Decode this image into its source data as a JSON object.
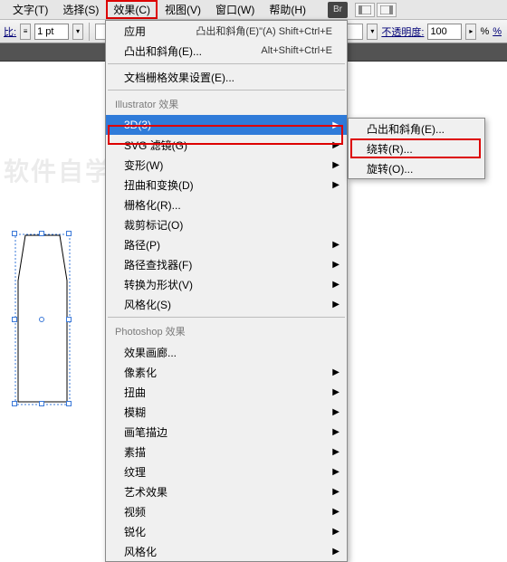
{
  "menubar": {
    "items": [
      "文字(T)",
      "选择(S)",
      "效果(C)",
      "视图(V)",
      "窗口(W)",
      "帮助(H)"
    ],
    "badge": "Br"
  },
  "toolbar": {
    "stroke_label": "比:",
    "stroke_value": "1 pt",
    "opacity_label": "不透明度:",
    "opacity_value": "100",
    "percent": "%"
  },
  "dropdown": {
    "top": [
      {
        "label": "应用",
        "shortcut": "凸出和斜角(E)\"(A)  Shift+Ctrl+E"
      },
      {
        "label": "凸出和斜角(E)...",
        "shortcut": "Alt+Shift+Ctrl+E"
      }
    ],
    "docfx": {
      "label": "文档栅格效果设置(E)..."
    },
    "header1": "Illustrator 效果",
    "group1": [
      {
        "label": "3D(3)",
        "arrow": true,
        "selected": true
      },
      {
        "label": "SVG 滤镜(G)",
        "arrow": true
      },
      {
        "label": "变形(W)",
        "arrow": true
      },
      {
        "label": "扭曲和变换(D)",
        "arrow": true
      },
      {
        "label": "栅格化(R)..."
      },
      {
        "label": "裁剪标记(O)"
      },
      {
        "label": "路径(P)",
        "arrow": true
      },
      {
        "label": "路径查找器(F)",
        "arrow": true
      },
      {
        "label": "转换为形状(V)",
        "arrow": true
      },
      {
        "label": "风格化(S)",
        "arrow": true
      }
    ],
    "header2": "Photoshop 效果",
    "group2": [
      {
        "label": "效果画廊...",
        "arrow": false
      },
      {
        "label": "像素化",
        "arrow": true
      },
      {
        "label": "扭曲",
        "arrow": true
      },
      {
        "label": "模糊",
        "arrow": true
      },
      {
        "label": "画笔描边",
        "arrow": true
      },
      {
        "label": "素描",
        "arrow": true
      },
      {
        "label": "纹理",
        "arrow": true
      },
      {
        "label": "艺术效果",
        "arrow": true
      },
      {
        "label": "视频",
        "arrow": true
      },
      {
        "label": "锐化",
        "arrow": true
      },
      {
        "label": "风格化",
        "arrow": true
      }
    ]
  },
  "submenu": {
    "items": [
      "凸出和斜角(E)...",
      "绕转(R)...",
      "旋转(O)..."
    ]
  },
  "watermark": "软件自学网"
}
